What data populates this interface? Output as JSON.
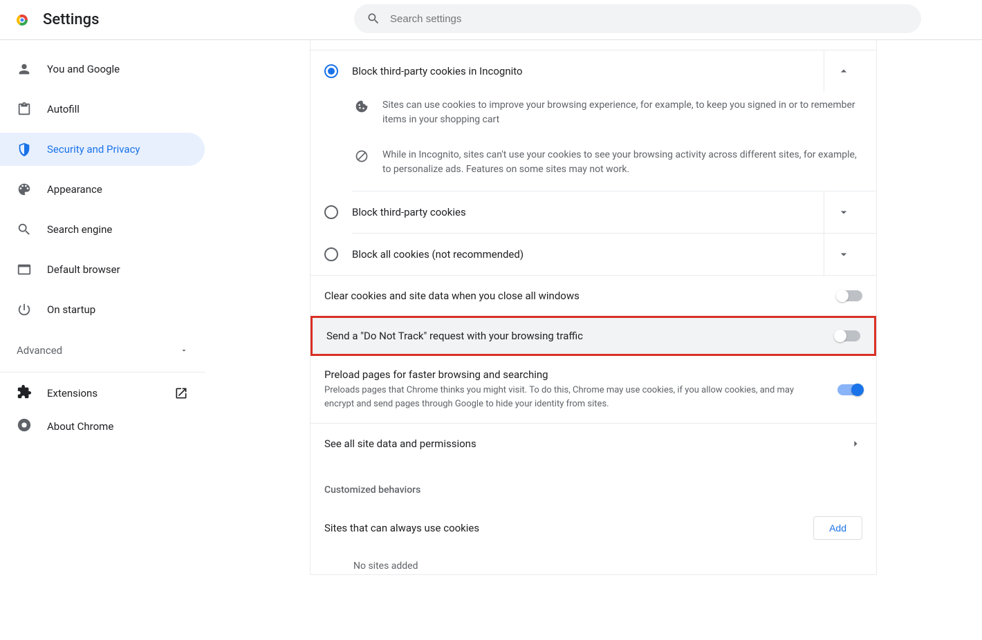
{
  "header": {
    "title": "Settings",
    "search_placeholder": "Search settings"
  },
  "sidebar": {
    "items": [
      {
        "label": "You and Google"
      },
      {
        "label": "Autofill"
      },
      {
        "label": "Security and Privacy"
      },
      {
        "label": "Appearance"
      },
      {
        "label": "Search engine"
      },
      {
        "label": "Default browser"
      },
      {
        "label": "On startup"
      }
    ],
    "advanced_label": "Advanced",
    "extensions_label": "Extensions",
    "about_label": "About Chrome"
  },
  "cookies": {
    "option_incognito": "Block third-party cookies in Incognito",
    "incognito_desc1": "Sites can use cookies to improve your browsing experience, for example, to keep you signed in or to remember items in your shopping cart",
    "incognito_desc2": "While in Incognito, sites can't use your cookies to see your browsing activity across different sites, for example, to personalize ads. Features on some sites may not work.",
    "option_third_party": "Block third-party cookies",
    "option_all": "Block all cookies (not recommended)"
  },
  "toggles": {
    "clear_on_close": "Clear cookies and site data when you close all windows",
    "do_not_track": "Send a \"Do Not Track\" request with your browsing traffic",
    "preload_title": "Preload pages for faster browsing and searching",
    "preload_desc": "Preloads pages that Chrome thinks you might visit. To do this, Chrome may use cookies, if you allow cookies, and may encrypt and send pages through Google to hide your identity from sites."
  },
  "links": {
    "see_all": "See all site data and permissions"
  },
  "custom": {
    "heading": "Customized behaviors",
    "always_title": "Sites that can always use cookies",
    "add_label": "Add",
    "no_sites": "No sites added"
  }
}
